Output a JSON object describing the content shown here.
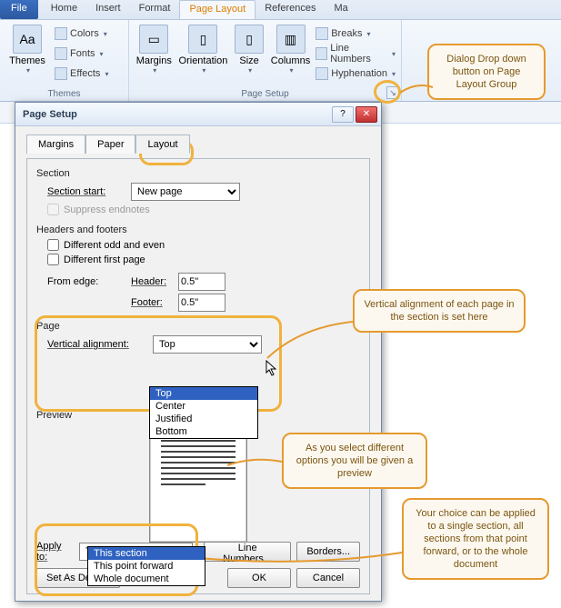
{
  "tabs": [
    "File",
    "Home",
    "Insert",
    "Format",
    "Page Layout",
    "References",
    "Ma"
  ],
  "activeTab": "Page Layout",
  "themesGroup": {
    "label": "Themes",
    "themes": "Themes",
    "colors": "Colors",
    "fonts": "Fonts",
    "effects": "Effects"
  },
  "pageSetupGroup": {
    "label": "Page Setup",
    "margins": "Margins",
    "orientation": "Orientation",
    "size": "Size",
    "columns": "Columns",
    "breaks": "Breaks",
    "lineNumbers": "Line Numbers",
    "hyphenation": "Hyphenation"
  },
  "dialog": {
    "title": "Page Setup",
    "tabs": {
      "margins": "Margins",
      "paper": "Paper",
      "layout": "Layout"
    },
    "section": {
      "header": "Section",
      "startLabel": "Section start:",
      "startValue": "New page",
      "suppress": "Suppress endnotes"
    },
    "hf": {
      "header": "Headers and footers",
      "diffOddEven": "Different odd and even",
      "diffFirst": "Different first page",
      "fromEdge": "From edge:",
      "hLabel": "Header:",
      "hVal": "0.5\"",
      "fLabel": "Footer:",
      "fVal": "0.5\""
    },
    "page": {
      "header": "Page",
      "vaLabel": "Vertical alignment:",
      "vaValue": "Top",
      "vaOptions": [
        "Top",
        "Center",
        "Justified",
        "Bottom"
      ]
    },
    "preview": "Preview",
    "applyTo": {
      "label": "Apply to:",
      "value": "This section",
      "options": [
        "This section",
        "This point forward",
        "Whole document"
      ]
    },
    "buttons": {
      "lineNumbers": "Line Numbers...",
      "borders": "Borders...",
      "setDefault": "Set As Default",
      "ok": "OK",
      "cancel": "Cancel"
    }
  },
  "callouts": {
    "c1": "Dialog Drop down button on Page Layout Group",
    "c2": "Vertical alignment of each page in the section is set here",
    "c3": "As you select different options you will be given a preview",
    "c4": "Your choice can be applied to a single section, all sections from that point forward, or to the whole document"
  }
}
